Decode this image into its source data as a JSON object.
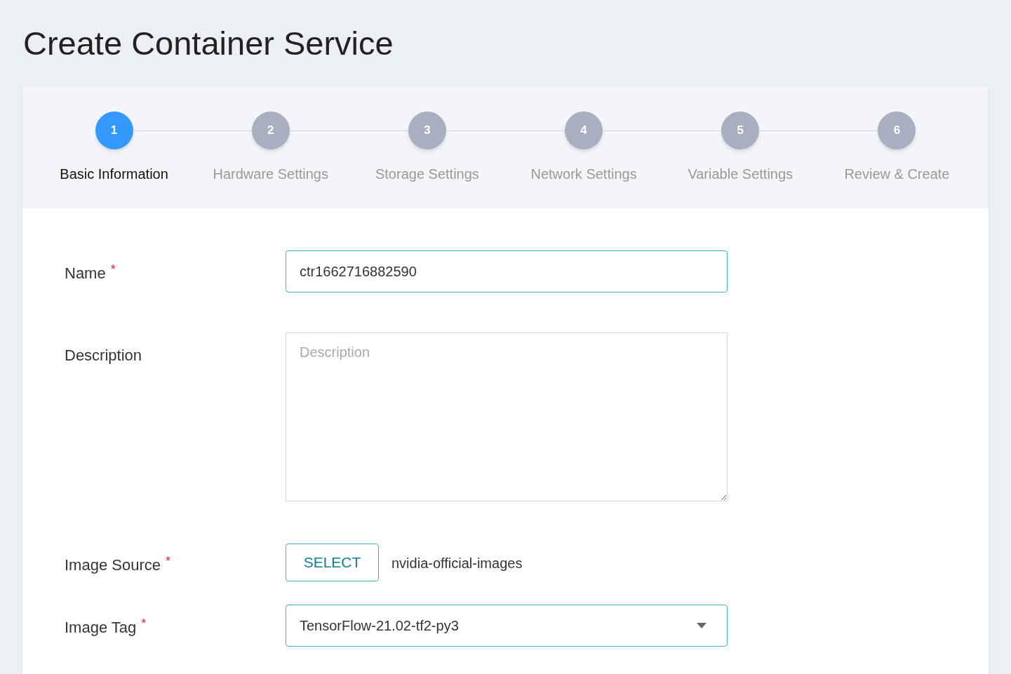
{
  "page_title": "Create Container Service",
  "steps": [
    {
      "number": "1",
      "label": "Basic Information",
      "selected": true
    },
    {
      "number": "2",
      "label": "Hardware Settings",
      "selected": false
    },
    {
      "number": "3",
      "label": "Storage Settings",
      "selected": false
    },
    {
      "number": "4",
      "label": "Network Settings",
      "selected": false
    },
    {
      "number": "5",
      "label": "Variable Settings",
      "selected": false
    },
    {
      "number": "6",
      "label": "Review & Create",
      "selected": false
    }
  ],
  "fields": [
    {
      "kind": "text",
      "label": "Name",
      "required_mark": "*",
      "value": "ctr1662716882590"
    },
    {
      "kind": "textarea",
      "label": "Description",
      "placeholder": "Description"
    },
    {
      "kind": "source",
      "label": "Image Source",
      "required_mark": "*",
      "button": "SELECT",
      "value": "nvidia-official-images"
    },
    {
      "kind": "select",
      "label": "Image Tag",
      "required_mark": "*",
      "value": "TensorFlow-21.02-tf2-py3"
    }
  ]
}
